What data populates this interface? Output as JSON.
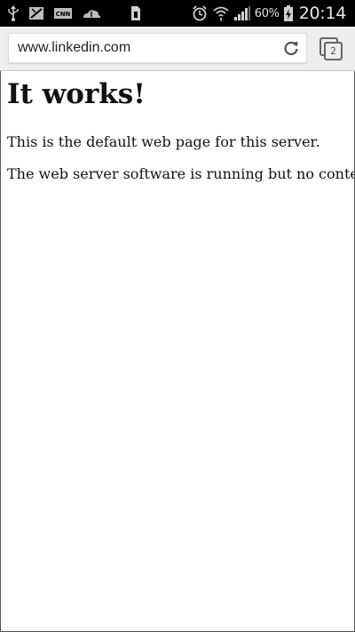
{
  "status_bar": {
    "battery_percent": "60%",
    "time": "20:14",
    "icons": [
      "usb-icon",
      "phone-icon",
      "cnn-icon",
      "cloud-icon",
      "sim-card-icon",
      "alarm-icon",
      "wifi-icon",
      "signal-icon",
      "battery-icon"
    ]
  },
  "browser": {
    "url": "www.linkedin.com",
    "tab_count": "2"
  },
  "page": {
    "heading": "It works!",
    "paragraph_1": "This is the default web page for this server.",
    "paragraph_2": "The web server software is running but no content has been added, yet."
  }
}
